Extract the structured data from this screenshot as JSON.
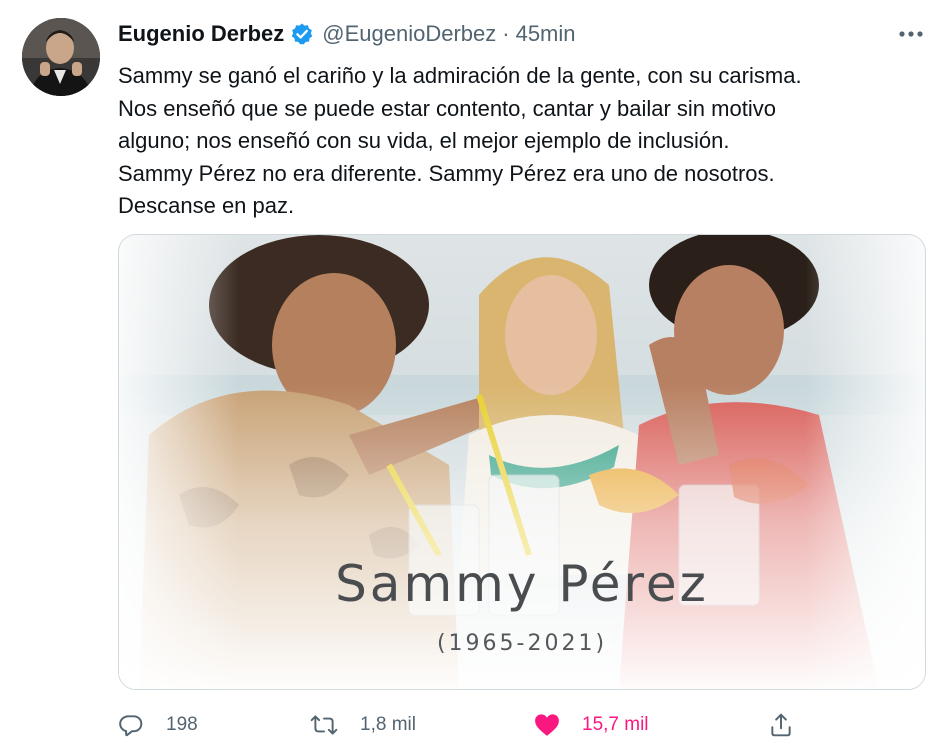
{
  "tweet": {
    "author_name": "Eugenio Derbez",
    "handle": "@EugenioDerbez",
    "separator": "·",
    "time": "45min",
    "text_lines": [
      "Sammy se ganó el cariño y la admiración de la gente, con su carisma.",
      "Nos enseñó que se puede estar contento, cantar y bailar sin motivo",
      "alguno; nos enseñó con su vida, el mejor ejemplo de inclusión.",
      "Sammy Pérez no era diferente. Sammy Pérez era uno de nosotros.",
      "Descanse en paz."
    ],
    "media": {
      "overlay_name": "Sammy Pérez",
      "overlay_years": "(1965-2021)"
    }
  },
  "actions": {
    "reply_count": "198",
    "retweet_count": "1,8 mil",
    "like_count": "15,7 mil",
    "like_active": true
  },
  "colors": {
    "verified": "#1d9bf0",
    "like": "#f91880",
    "secondary_text": "#536471",
    "border": "#cfd9de"
  },
  "icons": {
    "more": "more-icon",
    "reply": "reply-icon",
    "retweet": "retweet-icon",
    "like": "heart-icon",
    "share": "share-icon",
    "verified": "verified-badge-icon"
  }
}
